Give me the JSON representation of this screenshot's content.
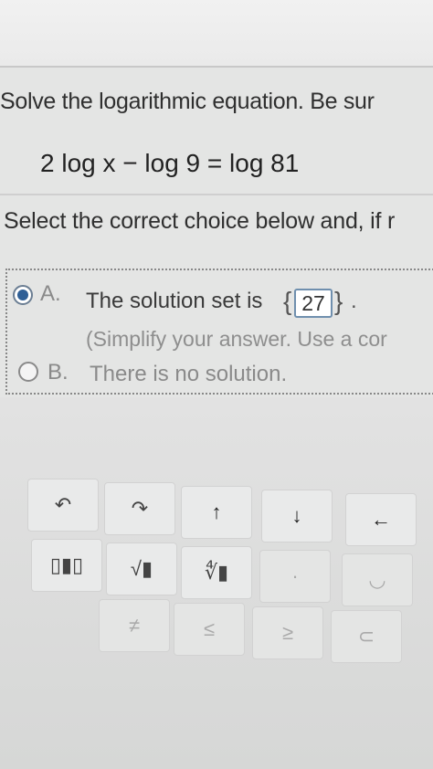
{
  "question": {
    "instructions": "Solve the logarithmic equation.  Be sur",
    "equation": "2 log x − log 9 = log 81",
    "prompt": "Select the correct choice below and, if r"
  },
  "choices": [
    {
      "letter": "A.",
      "text": "The solution set is",
      "brace_open": "{",
      "answer": "27",
      "brace_close": "}",
      "period": ".",
      "hint": "(Simplify your answer.  Use a cor",
      "selected": true
    },
    {
      "letter": "B.",
      "text": "There is no solution.",
      "selected": false
    }
  ],
  "toolbar": {
    "undo": "↶",
    "redo": "↷",
    "up": "↑",
    "down": "↓",
    "left": "←",
    "fraction": "▯▮▯",
    "sqrt": "√▮",
    "nthroot": "∜▮",
    "dot": "·",
    "clear": "◡",
    "r3c2": "≠",
    "r3c3": "≤",
    "r3c4": "≥",
    "r3c5": "⊂"
  },
  "colors": {
    "selected_radio": "#2f5f96",
    "answer_border": "#6f8fae",
    "background": "#e4e5e4"
  }
}
